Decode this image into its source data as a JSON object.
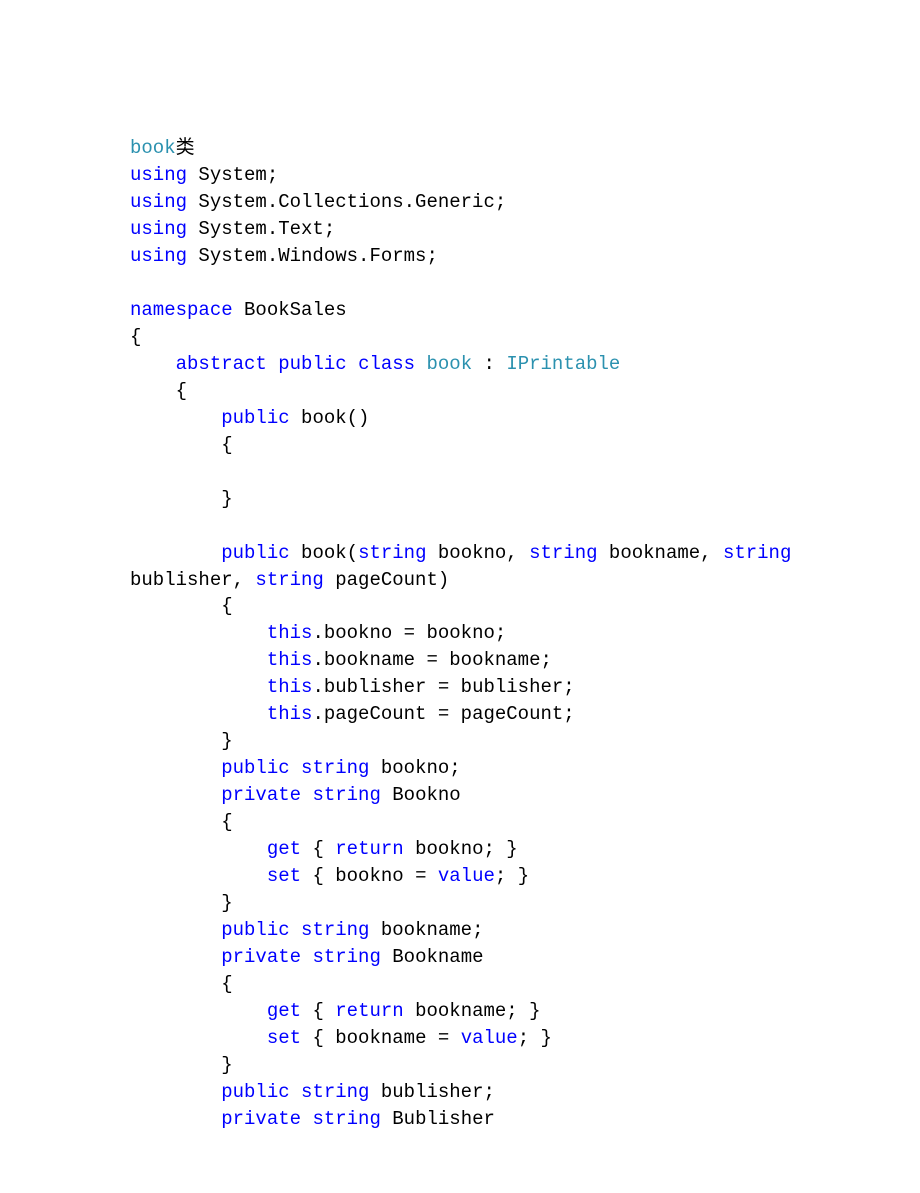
{
  "code": {
    "lines": [
      [
        {
          "t": "book",
          "c": "type"
        },
        {
          "t": "类",
          "c": "txt"
        }
      ],
      [
        {
          "t": "using",
          "c": "kw"
        },
        {
          "t": " System;",
          "c": "txt"
        }
      ],
      [
        {
          "t": "using",
          "c": "kw"
        },
        {
          "t": " System.Collections.Generic;",
          "c": "txt"
        }
      ],
      [
        {
          "t": "using",
          "c": "kw"
        },
        {
          "t": " System.Text;",
          "c": "txt"
        }
      ],
      [
        {
          "t": "using",
          "c": "kw"
        },
        {
          "t": " System.Windows.Forms;",
          "c": "txt"
        }
      ],
      [
        {
          "t": "",
          "c": "txt"
        }
      ],
      [
        {
          "t": "namespace",
          "c": "kw"
        },
        {
          "t": " BookSales",
          "c": "txt"
        }
      ],
      [
        {
          "t": "{",
          "c": "txt"
        }
      ],
      [
        {
          "t": "    ",
          "c": "txt"
        },
        {
          "t": "abstract",
          "c": "kw"
        },
        {
          "t": " ",
          "c": "txt"
        },
        {
          "t": "public",
          "c": "kw"
        },
        {
          "t": " ",
          "c": "txt"
        },
        {
          "t": "class",
          "c": "kw"
        },
        {
          "t": " ",
          "c": "txt"
        },
        {
          "t": "book",
          "c": "type"
        },
        {
          "t": " : ",
          "c": "txt"
        },
        {
          "t": "IPrintable",
          "c": "type"
        }
      ],
      [
        {
          "t": "    {",
          "c": "txt"
        }
      ],
      [
        {
          "t": "        ",
          "c": "txt"
        },
        {
          "t": "public",
          "c": "kw"
        },
        {
          "t": " book()",
          "c": "txt"
        }
      ],
      [
        {
          "t": "        {",
          "c": "txt"
        }
      ],
      [
        {
          "t": "",
          "c": "txt"
        }
      ],
      [
        {
          "t": "        }",
          "c": "txt"
        }
      ],
      [
        {
          "t": "",
          "c": "txt"
        }
      ],
      [
        {
          "t": "        ",
          "c": "txt"
        },
        {
          "t": "public",
          "c": "kw"
        },
        {
          "t": " book(",
          "c": "txt"
        },
        {
          "t": "string",
          "c": "kw"
        },
        {
          "t": " bookno, ",
          "c": "txt"
        },
        {
          "t": "string",
          "c": "kw"
        },
        {
          "t": " bookname, ",
          "c": "txt"
        },
        {
          "t": "string",
          "c": "kw"
        },
        {
          "t": " ",
          "c": "txt"
        }
      ],
      [
        {
          "t": "bublisher, ",
          "c": "txt"
        },
        {
          "t": "string",
          "c": "kw"
        },
        {
          "t": " pageCount)",
          "c": "txt"
        }
      ],
      [
        {
          "t": "        {",
          "c": "txt"
        }
      ],
      [
        {
          "t": "            ",
          "c": "txt"
        },
        {
          "t": "this",
          "c": "kw"
        },
        {
          "t": ".bookno = bookno;",
          "c": "txt"
        }
      ],
      [
        {
          "t": "            ",
          "c": "txt"
        },
        {
          "t": "this",
          "c": "kw"
        },
        {
          "t": ".bookname = bookname;",
          "c": "txt"
        }
      ],
      [
        {
          "t": "            ",
          "c": "txt"
        },
        {
          "t": "this",
          "c": "kw"
        },
        {
          "t": ".bublisher = bublisher;",
          "c": "txt"
        }
      ],
      [
        {
          "t": "            ",
          "c": "txt"
        },
        {
          "t": "this",
          "c": "kw"
        },
        {
          "t": ".pageCount = pageCount;",
          "c": "txt"
        }
      ],
      [
        {
          "t": "        }",
          "c": "txt"
        }
      ],
      [
        {
          "t": "        ",
          "c": "txt"
        },
        {
          "t": "public",
          "c": "kw"
        },
        {
          "t": " ",
          "c": "txt"
        },
        {
          "t": "string",
          "c": "kw"
        },
        {
          "t": " bookno;",
          "c": "txt"
        }
      ],
      [
        {
          "t": "        ",
          "c": "txt"
        },
        {
          "t": "private",
          "c": "kw"
        },
        {
          "t": " ",
          "c": "txt"
        },
        {
          "t": "string",
          "c": "kw"
        },
        {
          "t": " Bookno",
          "c": "txt"
        }
      ],
      [
        {
          "t": "        {",
          "c": "txt"
        }
      ],
      [
        {
          "t": "            ",
          "c": "txt"
        },
        {
          "t": "get",
          "c": "kw"
        },
        {
          "t": " { ",
          "c": "txt"
        },
        {
          "t": "return",
          "c": "kw"
        },
        {
          "t": " bookno; }",
          "c": "txt"
        }
      ],
      [
        {
          "t": "            ",
          "c": "txt"
        },
        {
          "t": "set",
          "c": "kw"
        },
        {
          "t": " { bookno = ",
          "c": "txt"
        },
        {
          "t": "value",
          "c": "kw"
        },
        {
          "t": "; }",
          "c": "txt"
        }
      ],
      [
        {
          "t": "        }",
          "c": "txt"
        }
      ],
      [
        {
          "t": "        ",
          "c": "txt"
        },
        {
          "t": "public",
          "c": "kw"
        },
        {
          "t": " ",
          "c": "txt"
        },
        {
          "t": "string",
          "c": "kw"
        },
        {
          "t": " bookname;",
          "c": "txt"
        }
      ],
      [
        {
          "t": "        ",
          "c": "txt"
        },
        {
          "t": "private",
          "c": "kw"
        },
        {
          "t": " ",
          "c": "txt"
        },
        {
          "t": "string",
          "c": "kw"
        },
        {
          "t": " Bookname",
          "c": "txt"
        }
      ],
      [
        {
          "t": "        {",
          "c": "txt"
        }
      ],
      [
        {
          "t": "            ",
          "c": "txt"
        },
        {
          "t": "get",
          "c": "kw"
        },
        {
          "t": " { ",
          "c": "txt"
        },
        {
          "t": "return",
          "c": "kw"
        },
        {
          "t": " bookname; }",
          "c": "txt"
        }
      ],
      [
        {
          "t": "            ",
          "c": "txt"
        },
        {
          "t": "set",
          "c": "kw"
        },
        {
          "t": " { bookname = ",
          "c": "txt"
        },
        {
          "t": "value",
          "c": "kw"
        },
        {
          "t": "; }",
          "c": "txt"
        }
      ],
      [
        {
          "t": "        }",
          "c": "txt"
        }
      ],
      [
        {
          "t": "        ",
          "c": "txt"
        },
        {
          "t": "public",
          "c": "kw"
        },
        {
          "t": " ",
          "c": "txt"
        },
        {
          "t": "string",
          "c": "kw"
        },
        {
          "t": " bublisher;",
          "c": "txt"
        }
      ],
      [
        {
          "t": "        ",
          "c": "txt"
        },
        {
          "t": "private",
          "c": "kw"
        },
        {
          "t": " ",
          "c": "txt"
        },
        {
          "t": "string",
          "c": "kw"
        },
        {
          "t": " Bublisher",
          "c": "txt"
        }
      ]
    ]
  }
}
